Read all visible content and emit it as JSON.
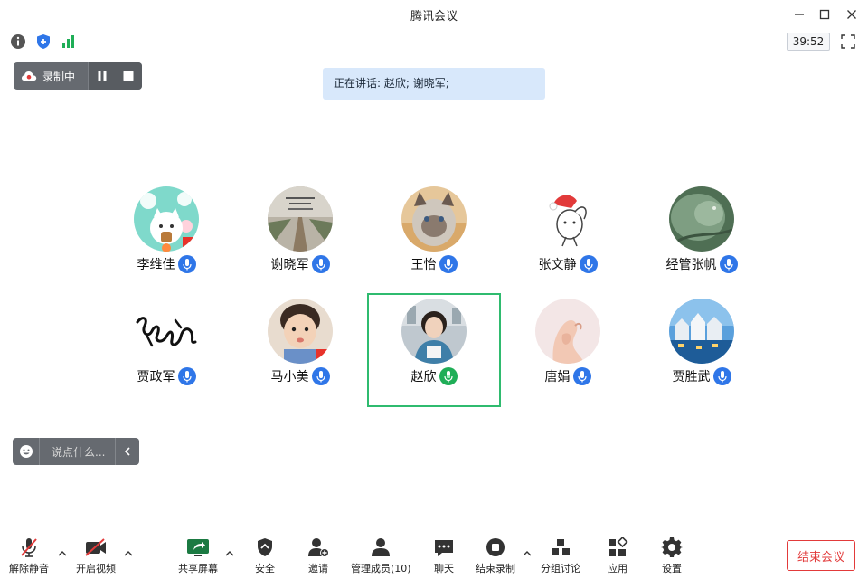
{
  "window": {
    "title": "腾讯会议"
  },
  "infobar": {
    "timer": "39:52"
  },
  "recording": {
    "label": "录制中"
  },
  "speaking": {
    "text": "正在讲话: 赵欣; 谢晓军;"
  },
  "participants": [
    {
      "name": "李维佳",
      "mic": "blue"
    },
    {
      "name": "谢晓军",
      "mic": "blue"
    },
    {
      "name": "王怡",
      "mic": "blue"
    },
    {
      "name": "张文静",
      "mic": "blue"
    },
    {
      "name": "经管张帆",
      "mic": "blue"
    },
    {
      "name": "贾政军",
      "mic": "blue"
    },
    {
      "name": "马小美",
      "mic": "blue"
    },
    {
      "name": "赵欣",
      "mic": "green",
      "active": true
    },
    {
      "name": "唐娟",
      "mic": "blue"
    },
    {
      "name": "贾胜武",
      "mic": "blue"
    }
  ],
  "chat": {
    "placeholder": "说点什么..."
  },
  "toolbar": {
    "unmute": "解除静音",
    "video": "开启视频",
    "share": "共享屏幕",
    "security": "安全",
    "invite": "邀请",
    "members": "管理成员(10)",
    "chat": "聊天",
    "stop_record": "结束录制",
    "breakout": "分组讨论",
    "apps": "应用",
    "settings": "设置",
    "end_meeting": "结束会议"
  },
  "colors": {
    "accent": "#2f76e8",
    "active_border": "#2fbb6f",
    "end": "#e23a3a"
  }
}
